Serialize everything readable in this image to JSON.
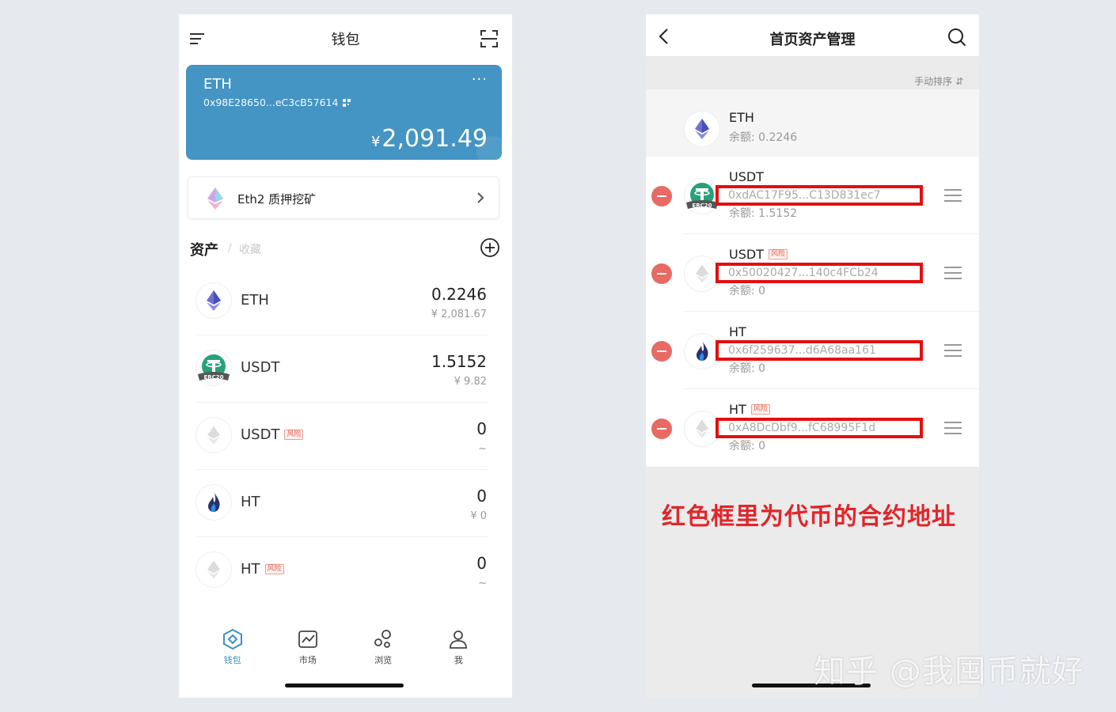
{
  "left": {
    "header": {
      "title": "钱包"
    },
    "wallet_card": {
      "name": "ETH",
      "address": "0x98E28650...eC3cB57614",
      "currency_symbol": "¥",
      "balance": "2,091.49",
      "more_label": "···"
    },
    "stake_banner": {
      "label": "Eth2 质押挖矿"
    },
    "assets_header": {
      "tab_assets": "资产",
      "separator": "/",
      "tab_favorites": "收藏"
    },
    "assets": [
      {
        "symbol": "ETH",
        "risk": "",
        "balance": "0.2246",
        "fiat": "¥ 2,081.67",
        "icon": "eth-icon"
      },
      {
        "symbol": "USDT",
        "risk": "",
        "balance": "1.5152",
        "fiat": "¥ 9.82",
        "icon": "usdt-erc20-icon"
      },
      {
        "symbol": "USDT",
        "risk": "风险",
        "balance": "0",
        "fiat": "~",
        "icon": "eth-gray-icon"
      },
      {
        "symbol": "HT",
        "risk": "",
        "balance": "0",
        "fiat": "¥ 0",
        "icon": "ht-icon"
      },
      {
        "symbol": "HT",
        "risk": "风险",
        "balance": "0",
        "fiat": "~",
        "icon": "eth-gray-icon"
      }
    ],
    "nav": [
      {
        "label": "钱包",
        "icon": "wallet-icon",
        "active": true
      },
      {
        "label": "市场",
        "icon": "market-icon",
        "active": false
      },
      {
        "label": "浏览",
        "icon": "browse-icon",
        "active": false
      },
      {
        "label": "我",
        "icon": "profile-icon",
        "active": false
      }
    ]
  },
  "right": {
    "header": {
      "title": "首页资产管理"
    },
    "sort_label": "手动排序 ⇵",
    "pinned": {
      "symbol": "ETH",
      "balance": "余额: 0.2246"
    },
    "rows": [
      {
        "symbol": "USDT",
        "risk": "",
        "address": "0xdAC17F95...C13D831ec7",
        "balance": "余额: 1.5152"
      },
      {
        "symbol": "USDT",
        "risk": "风险",
        "address": "0x50020427...140c4FCb24",
        "balance": "余额: 0"
      },
      {
        "symbol": "HT",
        "risk": "",
        "address": "0x6f259637...d6A68aa161",
        "balance": "余额: 0"
      },
      {
        "symbol": "HT",
        "risk": "风险",
        "address": "0xA8DcDbf9...fC68995F1d",
        "balance": "余额: 0"
      }
    ],
    "caption": "红色框里为代币的合约地址"
  },
  "watermark": "知乎 @我囤币就好",
  "colors": {
    "card_blue": "#4494c4",
    "accent_blue": "#3d8fc8",
    "highlight_red": "#e30f0f",
    "remove_red": "#e86a63"
  }
}
